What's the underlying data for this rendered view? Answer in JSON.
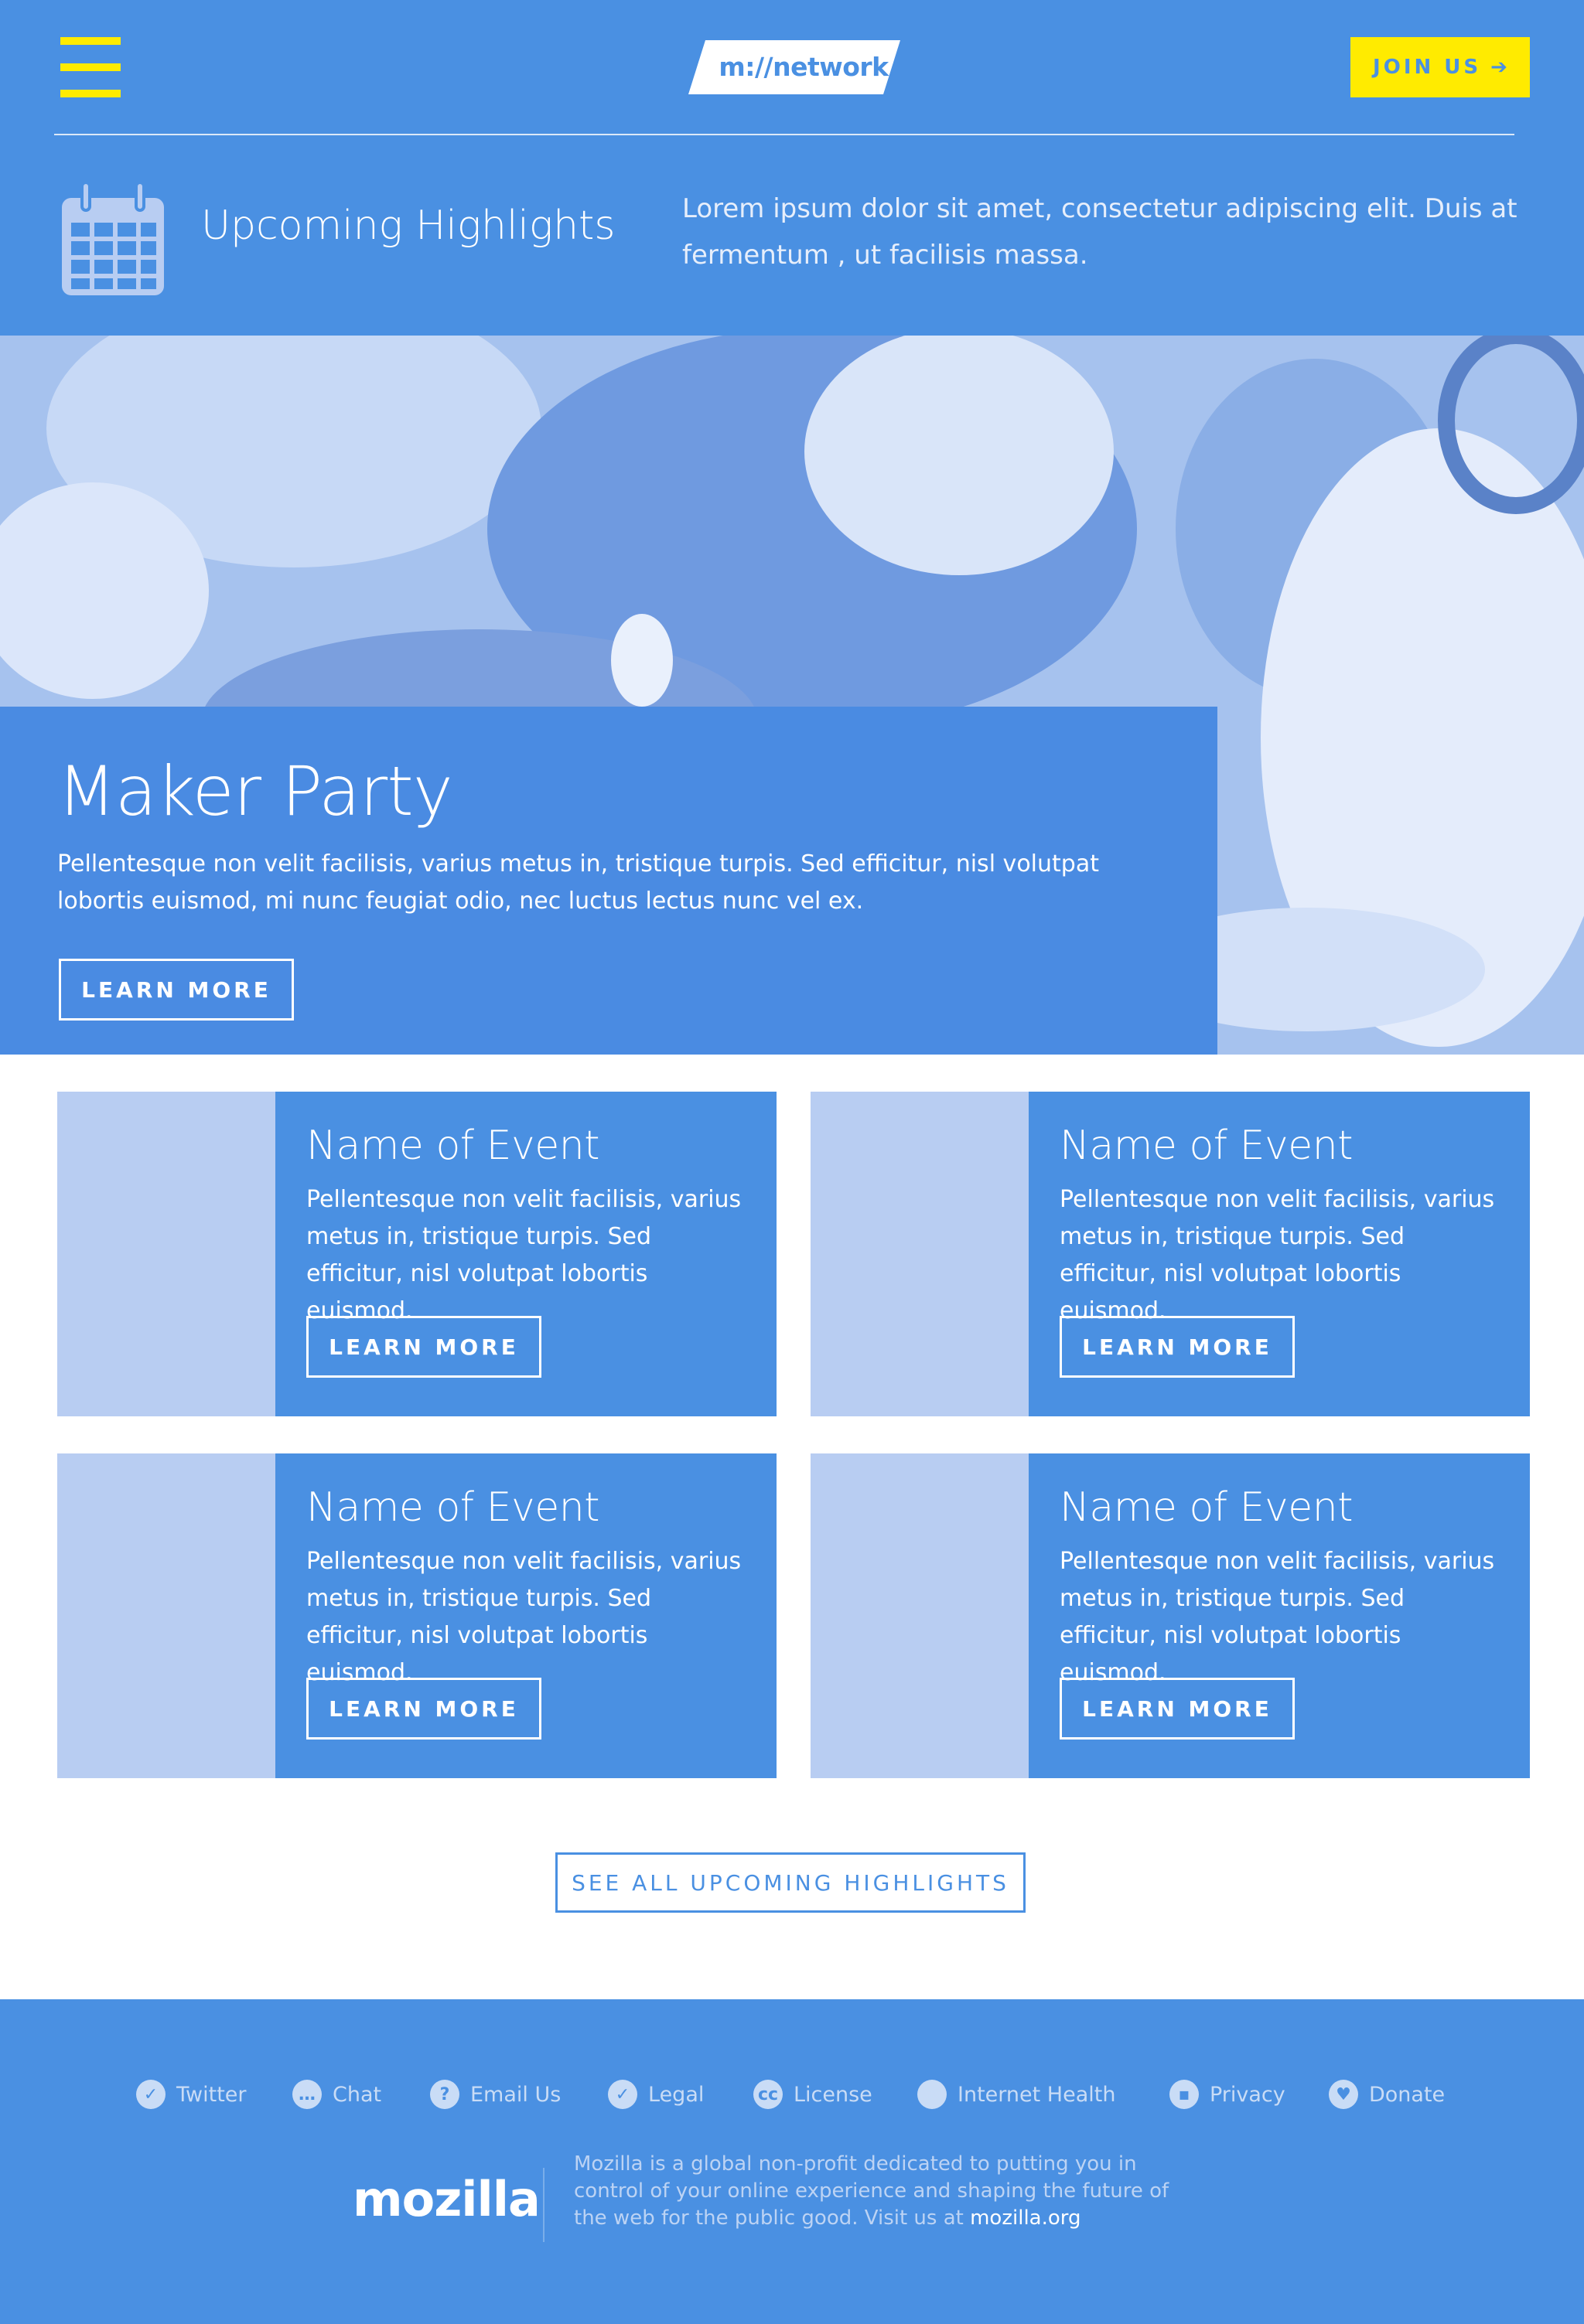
{
  "header": {
    "menu_icon": "hamburger-menu-icon",
    "logo_text": "m://network",
    "join_label": "JOIN US",
    "join_icon": "arrow-right-icon",
    "join_arrow": "➔",
    "section_icon": "calendar-icon",
    "section_title": "Upcoming Highlights",
    "section_desc": "Lorem ipsum dolor sit amet, consectetur adipiscing elit. Duis at fermentum , ut facilisis massa."
  },
  "hero": {
    "title": "Maker Party",
    "text": "Pellentesque non velit facilisis, varius metus in, tristique turpis. Sed efficitur, nisl volutpat lobortis euismod, mi nunc feugiat odio, nec luctus lectus nunc vel ex.",
    "button": "LEARN MORE"
  },
  "events": [
    {
      "title": "Name of Event",
      "text": "Pellentesque non velit facilisis, varius metus in, tristique turpis. Sed efficitur, nisl volutpat lobortis euismod.",
      "button": "LEARN MORE"
    },
    {
      "title": "Name of Event",
      "text": "Pellentesque non velit facilisis, varius metus in, tristique turpis. Sed efficitur, nisl volutpat lobortis euismod.",
      "button": "LEARN MORE"
    },
    {
      "title": "Name of Event",
      "text": "Pellentesque non velit facilisis, varius metus in, tristique turpis. Sed efficitur, nisl volutpat lobortis euismod.",
      "button": "LEARN MORE"
    },
    {
      "title": "Name of Event",
      "text": "Pellentesque non velit facilisis, varius metus in, tristique turpis. Sed efficitur, nisl volutpat lobortis euismod.",
      "button": "LEARN MORE"
    }
  ],
  "see_all": "SEE ALL UPCOMING HIGHLIGHTS",
  "footer": {
    "links": [
      {
        "label": "Twitter",
        "icon": "twitter-icon",
        "glyph": "✓"
      },
      {
        "label": "Chat",
        "icon": "chat-icon",
        "glyph": "…"
      },
      {
        "label": "Email Us",
        "icon": "help-icon",
        "glyph": "?"
      },
      {
        "label": "Legal",
        "icon": "check-icon",
        "glyph": "✓"
      },
      {
        "label": "License",
        "icon": "creative-commons-icon",
        "glyph": "cc"
      },
      {
        "label": "Internet Health",
        "icon": "globe-icon",
        "glyph": ""
      },
      {
        "label": "Privacy",
        "icon": "lock-icon",
        "glyph": "▪"
      },
      {
        "label": "Donate",
        "icon": "heart-icon",
        "glyph": "♥"
      }
    ],
    "logo": "mozilla",
    "about": "Mozilla is a global non-profit dedicated to putting you in control of your online experience and shaping the future of the web for the public good. Visit us at",
    "about_link": "mozilla.org"
  },
  "colors": {
    "brand_blue": "#4a90e2",
    "accent_yellow": "#ffeb00",
    "thumb_blue": "#b8cdf2"
  }
}
